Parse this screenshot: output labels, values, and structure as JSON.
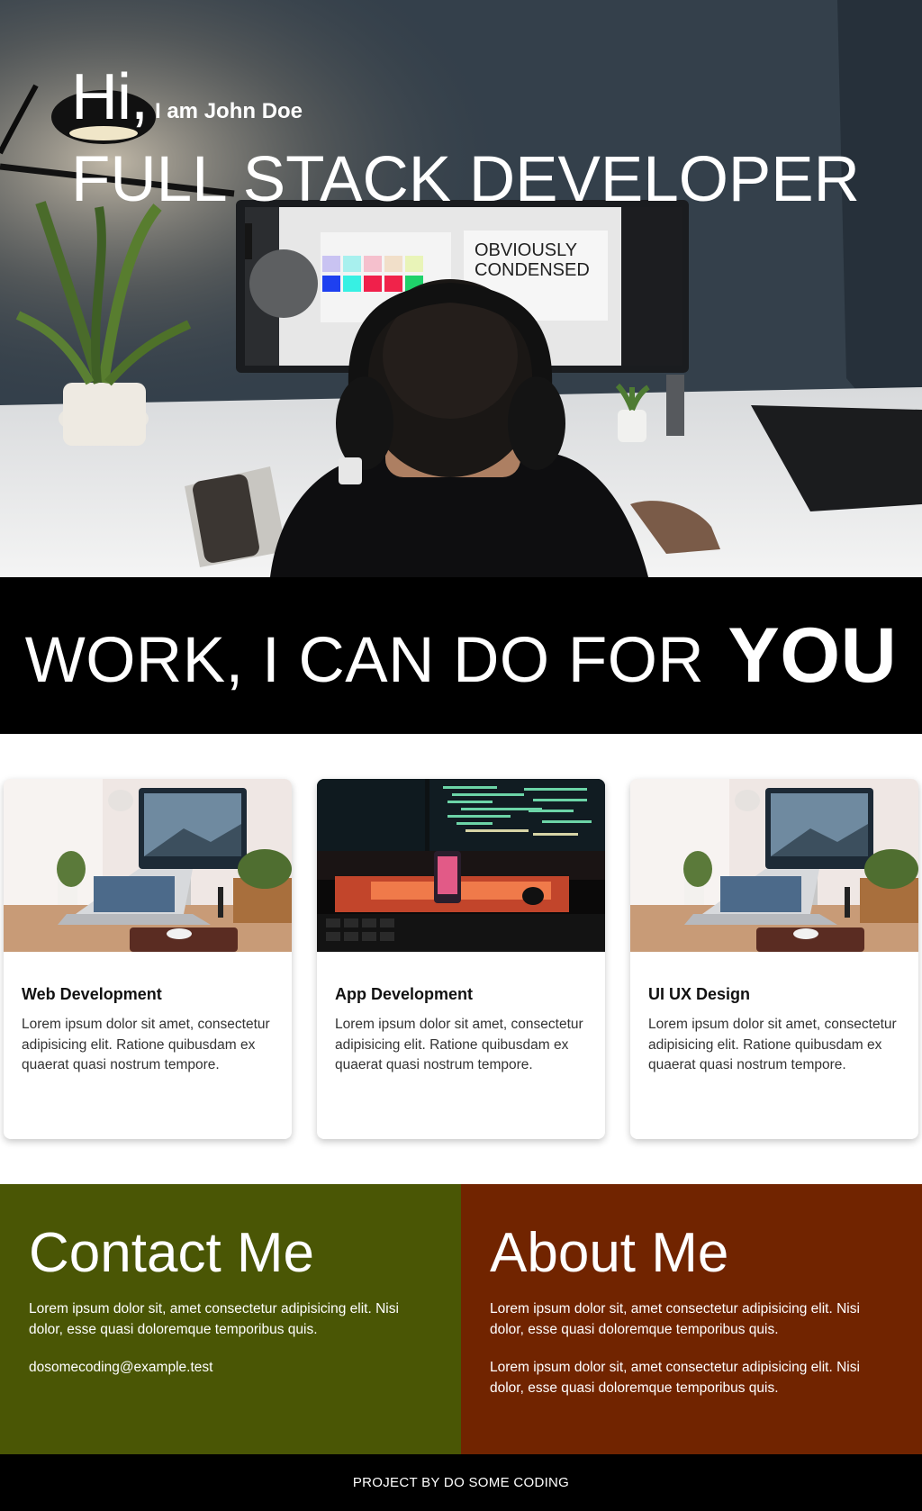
{
  "hero": {
    "greeting": "Hi,",
    "name": "I am John Doe",
    "title": "FULL STACK DEVELOPER",
    "screen_text_line1": "OBVIOUSLY",
    "screen_text_line2": "CONDENSED"
  },
  "banner": {
    "text": "WORK, I CAN DO FOR",
    "emphasis": "YOU"
  },
  "cards": [
    {
      "title": "Web Development",
      "text": "Lorem ipsum dolor sit amet, consectetur adipisicing elit. Ratione quibusdam ex quaerat quasi nostrum tempore."
    },
    {
      "title": "App Development",
      "text": "Lorem ipsum dolor sit amet, consectetur adipisicing elit. Ratione quibusdam ex quaerat quasi nostrum tempore."
    },
    {
      "title": "UI UX Design",
      "text": "Lorem ipsum dolor sit amet, consectetur adipisicing elit. Ratione quibusdam ex quaerat quasi nostrum tempore."
    }
  ],
  "contact": {
    "heading": "Contact Me",
    "text": "Lorem ipsum dolor sit, amet consectetur adipisicing elit. Nisi dolor, esse quasi doloremque temporibus quis.",
    "email": "dosomecoding@example.test"
  },
  "about": {
    "heading": "About Me",
    "text1": "Lorem ipsum dolor sit, amet consectetur adipisicing elit. Nisi dolor, esse quasi doloremque temporibus quis.",
    "text2": "Lorem ipsum dolor sit, amet consectetur adipisicing elit. Nisi dolor, esse quasi doloremque temporibus quis."
  },
  "footer": {
    "text": "PROJECT BY DO SOME CODING"
  },
  "colors": {
    "contact_bg": "#4a5605",
    "about_bg": "#712400",
    "banner_bg": "#000000"
  }
}
